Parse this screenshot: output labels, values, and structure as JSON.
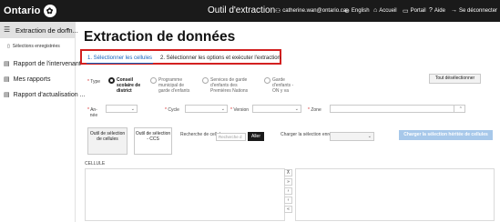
{
  "topbar": {
    "logo": "Ontario",
    "app_title": "Outil d'extraction",
    "user_email": "catherine.wan@ontario.ca",
    "language": "English",
    "home": "Accueil",
    "portal": "Portail",
    "help": "Aide",
    "logout": "Se déconnecter"
  },
  "sidebar": {
    "current": "Extraction de donn...",
    "sub_item": "Sélections enregistrées",
    "items": [
      {
        "label": "Rapport de l'intervenant"
      },
      {
        "label": "Mes rapports"
      },
      {
        "label": "Rapport d'actualisation ..."
      }
    ]
  },
  "main": {
    "title": "Extraction de données",
    "tabs": [
      {
        "label": "1. Sélectionner les cellules"
      },
      {
        "label": "2. Sélectionner les options et exécuter l'extraction"
      }
    ],
    "type_label": "Type",
    "type_options": [
      {
        "label": "Conseil scolaire de district",
        "selected": true
      },
      {
        "label": "Programme municipal de garde d'enfants",
        "selected": false
      },
      {
        "label": "Services de garde d'enfants des Premières Nations",
        "selected": false
      },
      {
        "label": "Garde d'enfants - ON y va",
        "selected": false
      }
    ],
    "deselect_all": "Tout désélectionner",
    "year_label_1": "An-",
    "year_label_2": "née",
    "cycle_label": "Cycle",
    "version_label": "Version",
    "zone_label": "Zone",
    "cell_tool_btn": "Outil de sélection de cellules",
    "ccs_tool_btn": "Outil de sélection - CCS",
    "cell_search_label": "Recherche de cellule",
    "cell_search_placeholder": "Recherche d",
    "go_btn": "Aller",
    "load_saved_label": "Charger la sélection enregistrée",
    "load_inherited_btn": "Charger la sélection héritée de cellules",
    "cell_header": "CELLULE",
    "arrows": [
      "⊼",
      "»",
      "›",
      "‹",
      "«"
    ]
  },
  "colors": {
    "accent": "#1565c0",
    "highlight": "#d32020",
    "topbar": "#1a1a1a",
    "disabled_button": "#a7c8ea"
  }
}
